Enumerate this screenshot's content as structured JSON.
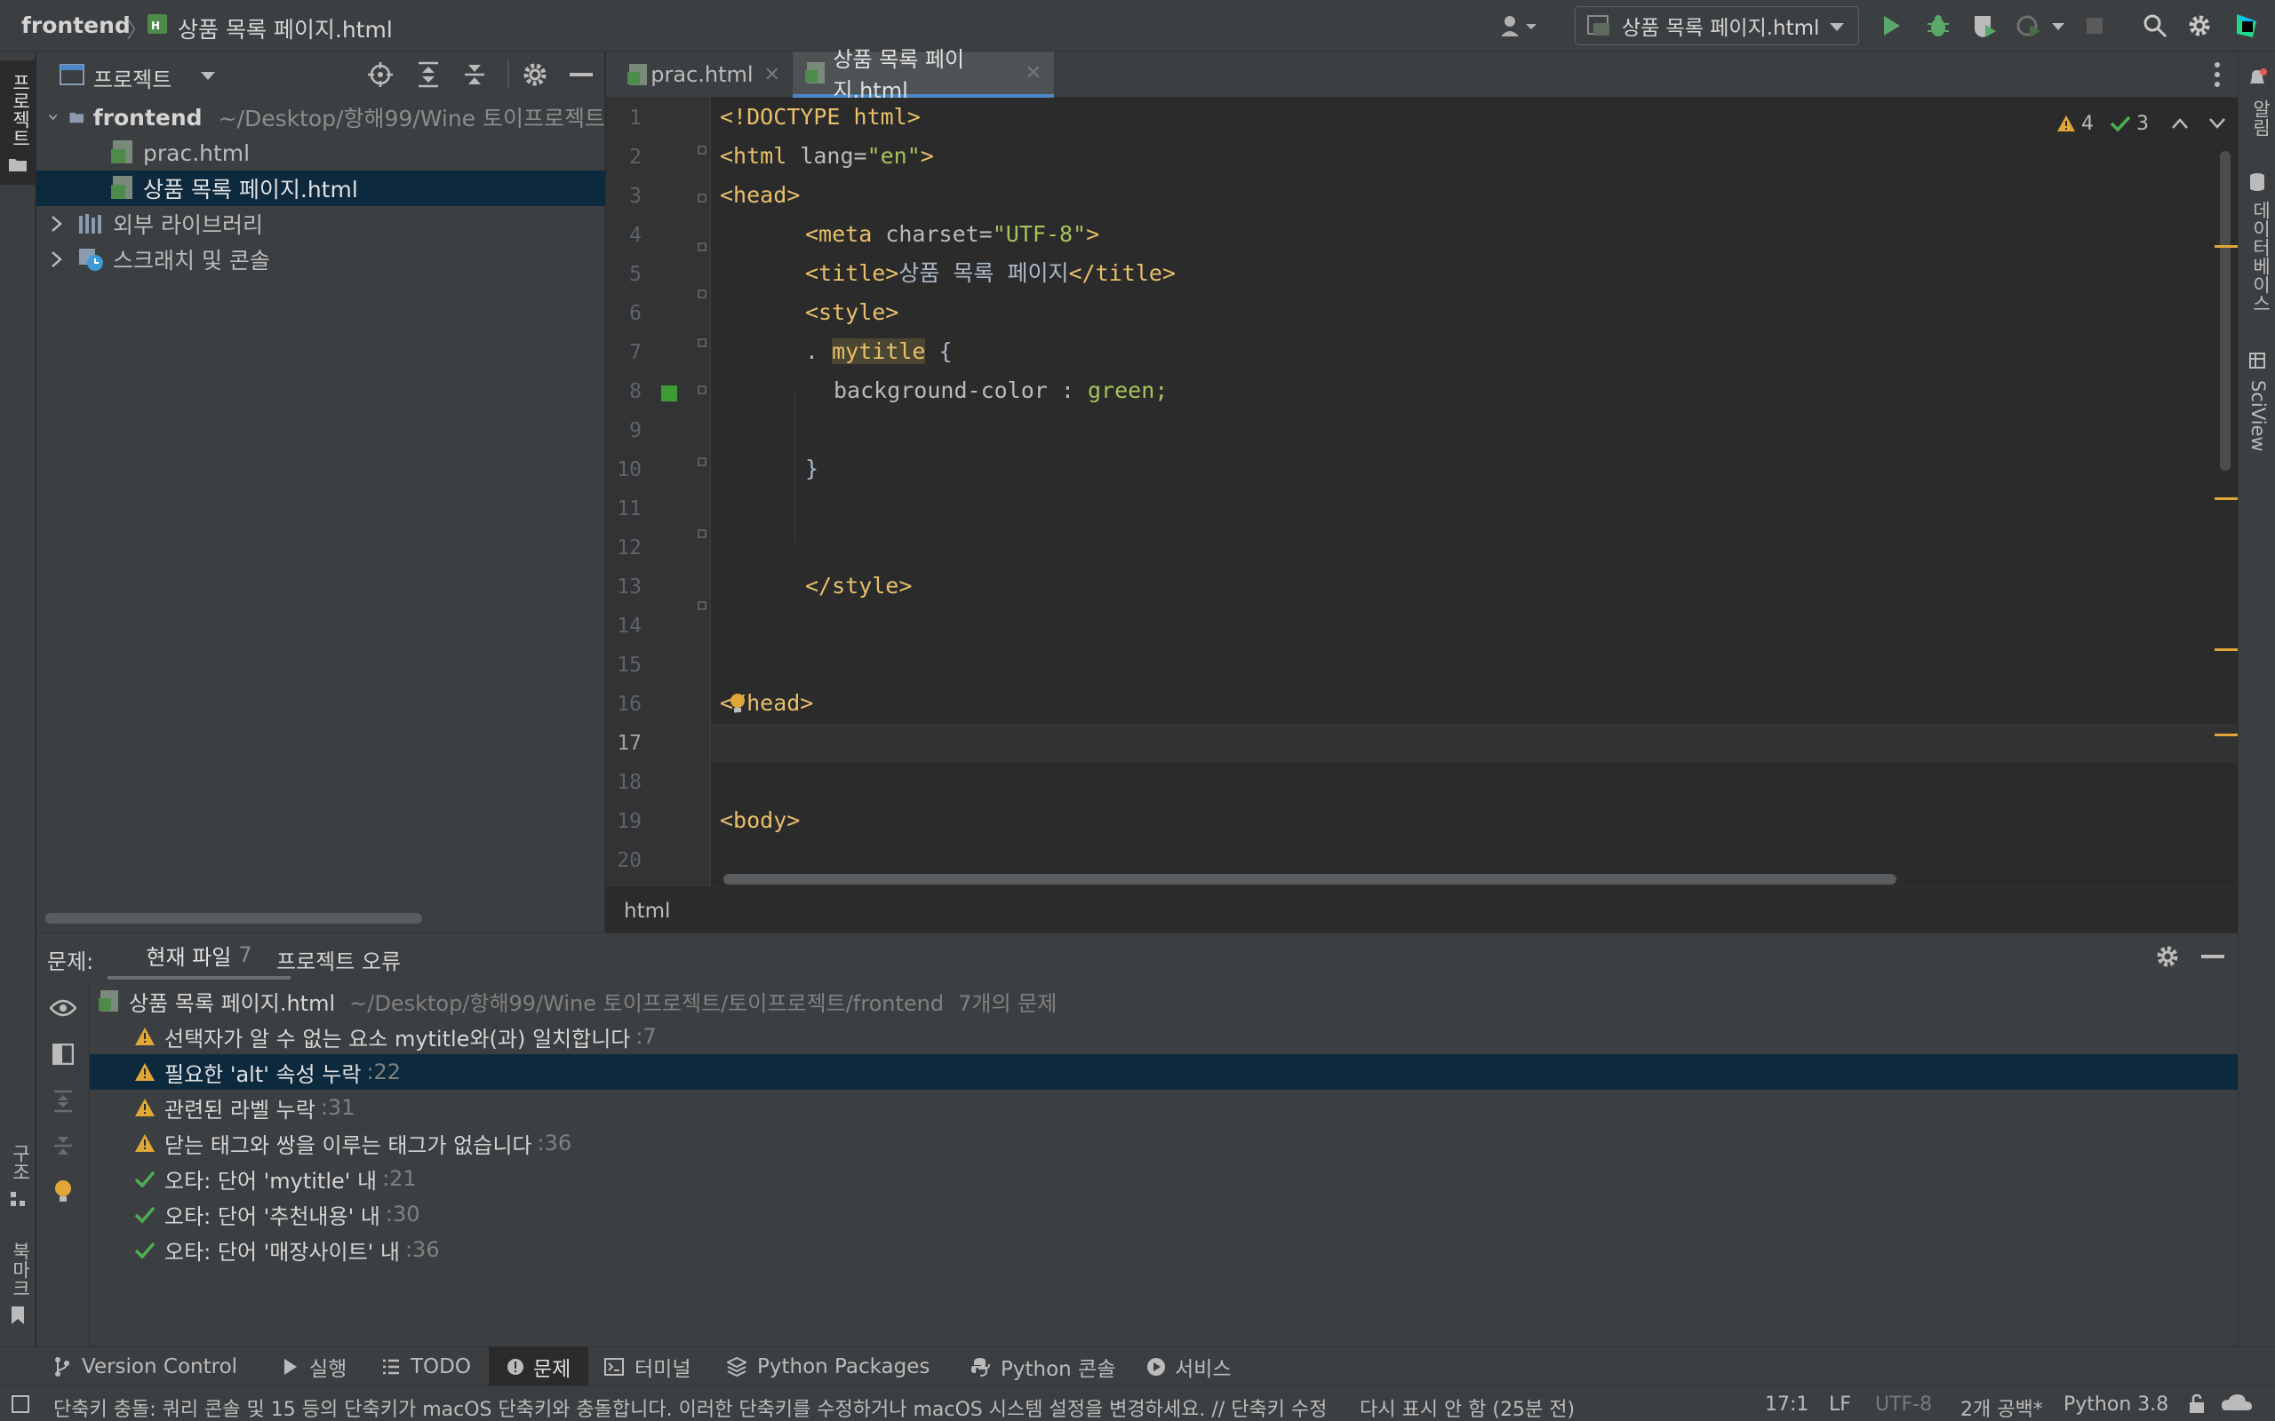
{
  "topbar": {
    "project": "frontend",
    "file": "상품 목록 페이지.html",
    "run_config": "상품 목록 페이지.html"
  },
  "left_strip": {
    "project_label": "프로젝트",
    "structure_label": "구조",
    "bookmarks_label": "북마크"
  },
  "right_strip": {
    "notifications_label": "알림",
    "database_label": "데이터베이스",
    "sciview_label": "SciView"
  },
  "project_panel": {
    "title": "프로젝트",
    "items": [
      {
        "label": "frontend",
        "path": "~/Desktop/항해99/Wine 토이프로젝트"
      },
      {
        "label": "prac.html"
      },
      {
        "label": "상품 목록 페이지.html"
      },
      {
        "label": "외부 라이브러리"
      },
      {
        "label": "스크래치 및 콘솔"
      }
    ]
  },
  "editor": {
    "tabs": [
      {
        "label": "prac.html"
      },
      {
        "label": "상품 목록 페이지.html"
      }
    ],
    "warnings": "4",
    "typos": "3",
    "line_numbers": [
      "1",
      "2",
      "3",
      "4",
      "5",
      "6",
      "7",
      "8",
      "9",
      "10",
      "11",
      "12",
      "13",
      "14",
      "15",
      "16",
      "17",
      "18",
      "19",
      "20"
    ],
    "code": {
      "l1": "<!DOCTYPE html>",
      "l2_open": "<html ",
      "l2_attr": "lang=",
      "l2_val": "\"en\"",
      "l2_close": ">",
      "l3": "<head>",
      "l4_open": "<meta ",
      "l4_attr": "charset=",
      "l4_val": "\"UTF-8\"",
      "l4_close": ">",
      "l5_open": "<title>",
      "l5_text": "상품 목록 페이지",
      "l5_close": "</title>",
      "l6": "<style>",
      "l7_dot": ". ",
      "l7_sel": "mytitle",
      "l7_brace": " {",
      "l8_prop": "background-color : ",
      "l8_val": "green;",
      "l10": "}",
      "l13": "</style>",
      "l16": "</head>",
      "l19": "<body>"
    },
    "breadcrumb": "html"
  },
  "problems": {
    "label": "문제:",
    "tab_current": "현재 파일",
    "tab_current_count": "7",
    "tab_project": "프로젝트 오류",
    "file_row": {
      "name": "상품 목록 페이지.html",
      "path": "~/Desktop/항해99/Wine 토이프로젝트/토이프로젝트/frontend",
      "count": "7개의 문제"
    },
    "items": [
      {
        "type": "warning",
        "text": "선택자가 알 수 없는 요소 mytitle와(과) 일치합니다",
        "line": ":7"
      },
      {
        "type": "warning",
        "text": "필요한 'alt' 속성 누락",
        "line": ":22"
      },
      {
        "type": "warning",
        "text": "관련된 라벨 누락",
        "line": ":31"
      },
      {
        "type": "warning",
        "text": "닫는 태그와 쌍을 이루는 태그가 없습니다",
        "line": ":36"
      },
      {
        "type": "typo",
        "text": "오타: 단어 'mytitle' 내",
        "line": ":21"
      },
      {
        "type": "typo",
        "text": "오타: 단어 '추천내용' 내",
        "line": ":30"
      },
      {
        "type": "typo",
        "text": "오타: 단어 '매장사이트' 내",
        "line": ":36"
      }
    ]
  },
  "tool_tabs": [
    {
      "label": "Version Control"
    },
    {
      "label": "실행"
    },
    {
      "label": "TODO"
    },
    {
      "label": "문제"
    },
    {
      "label": "터미널"
    },
    {
      "label": "Python Packages"
    },
    {
      "label": "Python 콘솔"
    },
    {
      "label": "서비스"
    }
  ],
  "statusbar": {
    "message": "단축키 충돌: 쿼리 콘솔 및 15 등의 단축키가 macOS 단축키와 충돌합니다. 이러한 단축키를 수정하거나 macOS 시스템 설정을 변경하세요. // 단축키 수정",
    "dismiss": "다시 표시 안 함 (25분 전)",
    "position": "17:1",
    "line_sep": "LF",
    "encoding": "UTF-8",
    "indent": "2개 공백*",
    "interpreter": "Python 3.8"
  },
  "colors": {
    "accent": "#4a88c7",
    "warning": "#e0a738",
    "ok": "#4fae52",
    "run": "#59a869",
    "selection": "#0d293e"
  }
}
